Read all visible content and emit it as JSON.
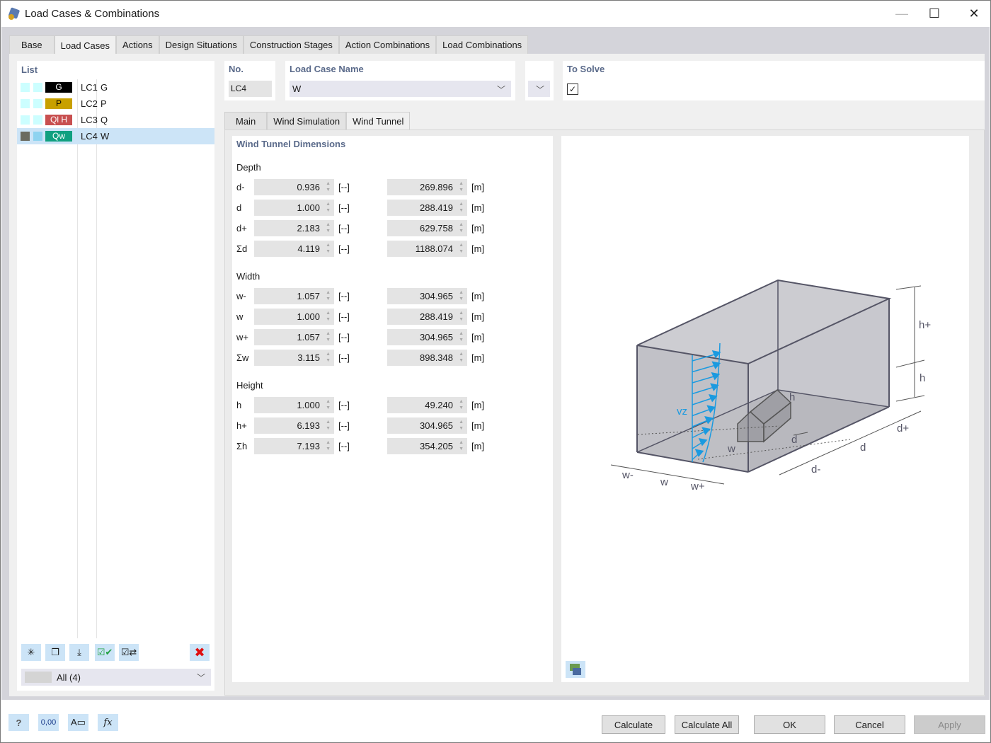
{
  "window": {
    "title": "Load Cases & Combinations",
    "minimize": "—",
    "maximize": "☐",
    "close": "✕"
  },
  "tabs": [
    {
      "label": "Base",
      "active": false
    },
    {
      "label": "Load Cases",
      "active": true
    },
    {
      "label": "Actions",
      "active": false
    },
    {
      "label": "Design Situations",
      "active": false
    },
    {
      "label": "Construction Stages",
      "active": false
    },
    {
      "label": "Action Combinations",
      "active": false
    },
    {
      "label": "Load Combinations",
      "active": false
    }
  ],
  "list": {
    "title": "List",
    "items": [
      {
        "sq1": "#ccfeff",
        "sq2": "#ccfeff",
        "badge": "G",
        "badge_bg": "#000000",
        "badge_fg": "#ffffff",
        "id": "LC1",
        "name": "G",
        "selected": false
      },
      {
        "sq1": "#ccfeff",
        "sq2": "#ccfeff",
        "badge": "P",
        "badge_bg": "#c8a000",
        "badge_fg": "#000000",
        "id": "LC2",
        "name": "P",
        "selected": false
      },
      {
        "sq1": "#ccfeff",
        "sq2": "#ccfeff",
        "badge": "Ql H",
        "badge_bg": "#c85050",
        "badge_fg": "#ffffff",
        "id": "LC3",
        "name": "Q",
        "selected": false
      },
      {
        "sq1": "#6b6b60",
        "sq2": "#8ed3f0",
        "badge": "Qw",
        "badge_bg": "#10a080",
        "badge_fg": "#ffffff",
        "id": "LC4",
        "name": "W",
        "selected": true
      }
    ],
    "tools": [
      {
        "name": "new-item-icon",
        "glyph": "✳"
      },
      {
        "name": "copy-item-icon",
        "glyph": "❐"
      },
      {
        "name": "import-icon",
        "glyph": "⤓"
      },
      {
        "name": "check-all-icon",
        "glyph": "☑✔"
      },
      {
        "name": "toggle-check-icon",
        "glyph": "☑⇄"
      },
      {
        "name": "delete-icon",
        "glyph": "✖"
      }
    ],
    "filter": "All (4)"
  },
  "header": {
    "no_label": "No.",
    "no_value": "LC4",
    "name_label": "Load Case Name",
    "name_value": "W",
    "to_solve_label": "To Solve",
    "to_solve_checked": true,
    "check_glyph": "✓",
    "chevron": "﹀"
  },
  "subtabs": [
    {
      "label": "Main",
      "active": false
    },
    {
      "label": "Wind Simulation",
      "active": false
    },
    {
      "label": "Wind Tunnel",
      "active": true
    }
  ],
  "dimensions": {
    "title": "Wind Tunnel Dimensions",
    "groups": [
      {
        "label": "Depth",
        "rows": [
          {
            "label": "d-",
            "factor": "0.936",
            "factor_unit": "[--]",
            "value": "269.896",
            "unit": "[m]"
          },
          {
            "label": "d",
            "factor": "1.000",
            "factor_unit": "[--]",
            "value": "288.419",
            "unit": "[m]"
          },
          {
            "label": "d+",
            "factor": "2.183",
            "factor_unit": "[--]",
            "value": "629.758",
            "unit": "[m]"
          },
          {
            "label": "Σd",
            "factor": "4.119",
            "factor_unit": "[--]",
            "value": "1188.074",
            "unit": "[m]"
          }
        ]
      },
      {
        "label": "Width",
        "rows": [
          {
            "label": "w-",
            "factor": "1.057",
            "factor_unit": "[--]",
            "value": "304.965",
            "unit": "[m]"
          },
          {
            "label": "w",
            "factor": "1.000",
            "factor_unit": "[--]",
            "value": "288.419",
            "unit": "[m]"
          },
          {
            "label": "w+",
            "factor": "1.057",
            "factor_unit": "[--]",
            "value": "304.965",
            "unit": "[m]"
          },
          {
            "label": "Σw",
            "factor": "3.115",
            "factor_unit": "[--]",
            "value": "898.348",
            "unit": "[m]"
          }
        ]
      },
      {
        "label": "Height",
        "rows": [
          {
            "label": "h",
            "factor": "1.000",
            "factor_unit": "[--]",
            "value": "49.240",
            "unit": "[m]"
          },
          {
            "label": "h+",
            "factor": "6.193",
            "factor_unit": "[--]",
            "value": "304.965",
            "unit": "[m]"
          },
          {
            "label": "Σh",
            "factor": "7.193",
            "factor_unit": "[--]",
            "value": "354.205",
            "unit": "[m]"
          }
        ]
      }
    ]
  },
  "diagram": {
    "labels": {
      "vz": "vz",
      "h_plus": "h+",
      "h": "h",
      "h_bld": "h",
      "d_plus": "d+",
      "d": "d",
      "d_minus": "d-",
      "d_bld": "d",
      "w_minus": "w-",
      "w": "w",
      "w_plus": "w+",
      "w_bld": "w"
    },
    "colors": {
      "tunnel_fill": "#c4c4ca",
      "tunnel_edge": "#555566",
      "wind": "#1a9ae0",
      "building": "#8a8a8a"
    }
  },
  "footer": {
    "icons": [
      {
        "name": "help-icon",
        "glyph": "?"
      },
      {
        "name": "units-icon",
        "glyph": "0,00"
      },
      {
        "name": "display-settings-icon",
        "glyph": "A▭"
      },
      {
        "name": "formula-icon",
        "glyph": "fx"
      }
    ],
    "buttons": {
      "calculate": "Calculate",
      "calculate_all": "Calculate All",
      "ok": "OK",
      "cancel": "Cancel",
      "apply": "Apply"
    }
  }
}
